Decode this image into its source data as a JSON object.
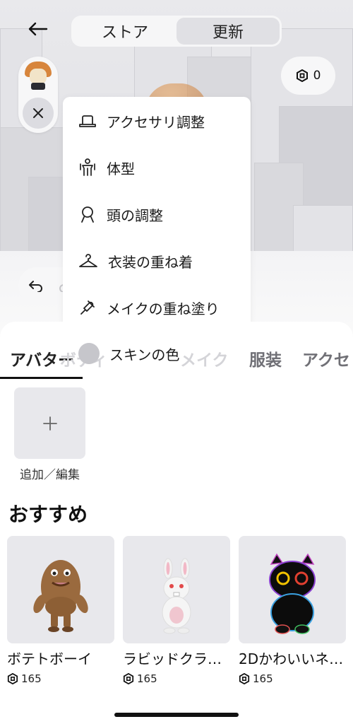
{
  "topbar": {
    "tabs": [
      {
        "label": "ストア",
        "active": false
      },
      {
        "label": "更新",
        "active": true
      }
    ]
  },
  "currency": {
    "icon": "robux-icon",
    "amount": "0"
  },
  "menu": {
    "items": [
      {
        "label": "アクセサリ調整",
        "icon": "hat-icon"
      },
      {
        "label": "体型",
        "icon": "body-icon"
      },
      {
        "label": "頭の調整",
        "icon": "head-icon"
      },
      {
        "label": "衣装の重ね着",
        "icon": "hanger-icon"
      },
      {
        "label": "メイクの重ね塗り",
        "icon": "makeup-icon"
      },
      {
        "label": "スキンの色",
        "icon": "skin-color-icon"
      }
    ]
  },
  "category_tabs": [
    {
      "label": "アバター",
      "active": true
    },
    {
      "label": "ボディ",
      "faded": true
    },
    {
      "label": "メイク",
      "faded": true
    },
    {
      "label": "服装"
    },
    {
      "label": "アクセ"
    }
  ],
  "add_edit_label": "追加／編集",
  "recommended": {
    "title": "おすすめ",
    "items": [
      {
        "name": "ボテトボーイ",
        "price": "165"
      },
      {
        "name": "ラビッドクラ…",
        "price": "165"
      },
      {
        "name": "2Dかわいいネ…",
        "price": "165"
      }
    ]
  },
  "colors": {
    "accent": "#111111",
    "tile_bg": "#e8e8ec",
    "skin_dot": "#c6c6cb"
  }
}
